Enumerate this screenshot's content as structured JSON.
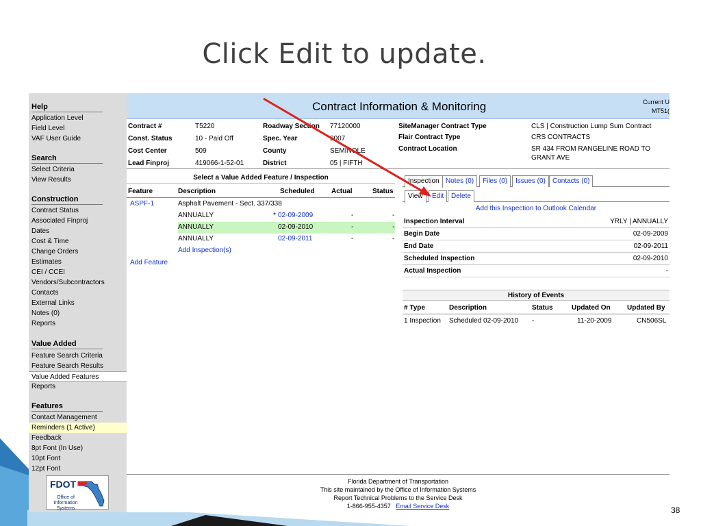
{
  "slide": {
    "title": "Click Edit to update.",
    "number": "38"
  },
  "sidebar": {
    "sections": [
      {
        "heading": "Help",
        "items": [
          "Application Level",
          "Field Level",
          "VAF User Guide"
        ]
      },
      {
        "heading": "Search",
        "items": [
          "Select Criteria",
          "View Results"
        ]
      },
      {
        "heading": "Construction",
        "items": [
          "Contract Status",
          "Associated Finproj",
          "Dates",
          "Cost & Time",
          "Change Orders",
          "Estimates",
          "CEI / CCEI",
          "Vendors/Subcontractors",
          "Contacts",
          "External Links",
          "Notes (0)",
          "Reports"
        ]
      },
      {
        "heading": "Value Added",
        "items": [
          "Feature Search Criteria",
          "Feature Search Results",
          "Value Added Features",
          "Reports"
        ]
      },
      {
        "heading": "Features",
        "items": [
          "Contact Management",
          "Reminders (1 Active)",
          "Feedback",
          "8pt Font (In Use)",
          "10pt Font",
          "12pt Font"
        ]
      }
    ],
    "logo": {
      "text": "FDOT",
      "sub": "Office of Information Systems"
    }
  },
  "header": {
    "title": "Contract Information & Monitoring",
    "user_label": "Current U",
    "user_id": "MT51("
  },
  "contract": {
    "left": [
      {
        "label": "Contract #",
        "value": "T5220"
      },
      {
        "label": "Const. Status",
        "value": "10 - Paid Off"
      },
      {
        "label": "Cost Center",
        "value": "509"
      },
      {
        "label": "Lead Finproj",
        "value": "419066-1-52-01"
      }
    ],
    "mid": [
      {
        "label": "Roadway Section",
        "value": "77120000"
      },
      {
        "label": "Spec. Year",
        "value": "2007"
      },
      {
        "label": "County",
        "value": "SEMINOLE"
      },
      {
        "label": "District",
        "value": "05 | FIFTH"
      }
    ],
    "right": [
      {
        "label": "SiteManager Contract Type",
        "value": "CLS | Construction Lump Sum Contract"
      },
      {
        "label": "Flair Contract Type",
        "value": "CRS CONTRACTS"
      },
      {
        "label": "Contract Location",
        "value": "SR 434 FROM RANGELINE ROAD TO",
        "value2": "GRANT AVE"
      }
    ]
  },
  "features": {
    "caption": "Select a Value Added Feature / Inspection",
    "headers": [
      "Feature",
      "Description",
      "Scheduled",
      "Actual",
      "Status"
    ],
    "rows": [
      {
        "feature": "ASPF-1",
        "description": "Asphalt Pavement - Sect. 337/338",
        "scheduled": "",
        "actual": "",
        "status": ""
      },
      {
        "feature": "",
        "description": "ANNUALLY",
        "marker": "*",
        "scheduled": "02-09-2009",
        "actual": "-",
        "status": "-"
      },
      {
        "feature": "",
        "description": "ANNUALLY",
        "scheduled": "02-09-2010",
        "actual": "-",
        "status": "-"
      },
      {
        "feature": "",
        "description": "ANNUALLY",
        "scheduled": "02-09-2011",
        "actual": "-",
        "status": "-"
      }
    ],
    "add_inspection": "Add Inspection(s)",
    "add_feature": "Add Feature"
  },
  "tabs": [
    "Inspection",
    "Notes (0)",
    "Files (0)",
    "Issues (0)",
    "Contacts (0)"
  ],
  "subtabs": [
    "View",
    "Edit",
    "Delete"
  ],
  "inspection": {
    "outlook_link": "Add this Inspection to Outlook Calendar",
    "fields": [
      {
        "label": "Inspection Interval",
        "value": "YRLY | ANNUALLY"
      },
      {
        "label": "Begin Date",
        "value": "02-09-2009"
      },
      {
        "label": "End Date",
        "value": "02-09-2011"
      },
      {
        "label": "Scheduled Inspection",
        "value": "02-09-2010"
      },
      {
        "label": "Actual Inspection",
        "value": "-"
      }
    ]
  },
  "history": {
    "title": "History of Events",
    "headers": [
      "# Type",
      "Description",
      "Status",
      "Updated On",
      "Updated By"
    ],
    "row": [
      "1  Inspection",
      "Scheduled 02-09-2010",
      "-",
      "11-20-2009",
      "CN506SL"
    ]
  },
  "footer": {
    "line1": "Florida Department of Transportation",
    "line2": "This site maintained by the Office of Information Systems",
    "line3": "Report Technical Problems to the Service Desk",
    "phone": "1-866-955-4357",
    "email_link": "Email Service Desk"
  },
  "colors": {
    "header_bg": "#c6dff5",
    "sidebar_bg": "#dcdcdc",
    "link": "#1133cc",
    "highlight_row": "#c9f5c0",
    "annotation_arrow": "#e0201b"
  }
}
